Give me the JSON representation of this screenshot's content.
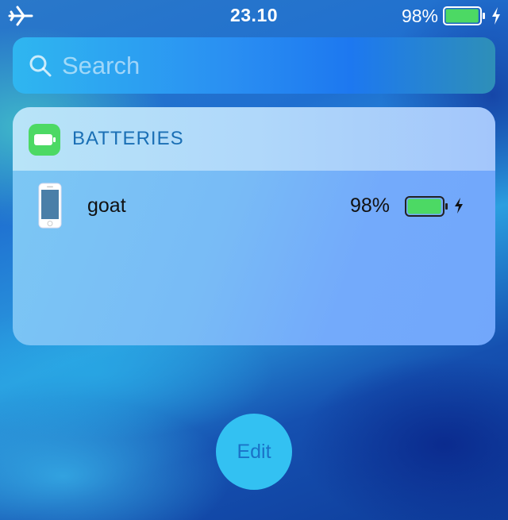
{
  "status_bar": {
    "time": "23.10",
    "battery_percent_label": "98%",
    "battery_level": 0.98,
    "charging": true,
    "airplane_mode": true
  },
  "search": {
    "placeholder": "Search"
  },
  "widget": {
    "title": "BATTERIES",
    "icon": "battery-app-icon",
    "devices": [
      {
        "name": "goat",
        "percent_label": "98%",
        "level": 0.98,
        "charging": true,
        "icon": "iphone-icon"
      }
    ]
  },
  "edit_button": {
    "label": "Edit"
  },
  "colors": {
    "battery_green": "#4cd964",
    "widget_title": "#1a6fb5",
    "edit_text": "#1a73c8",
    "edit_bg": "#33c1f2"
  }
}
